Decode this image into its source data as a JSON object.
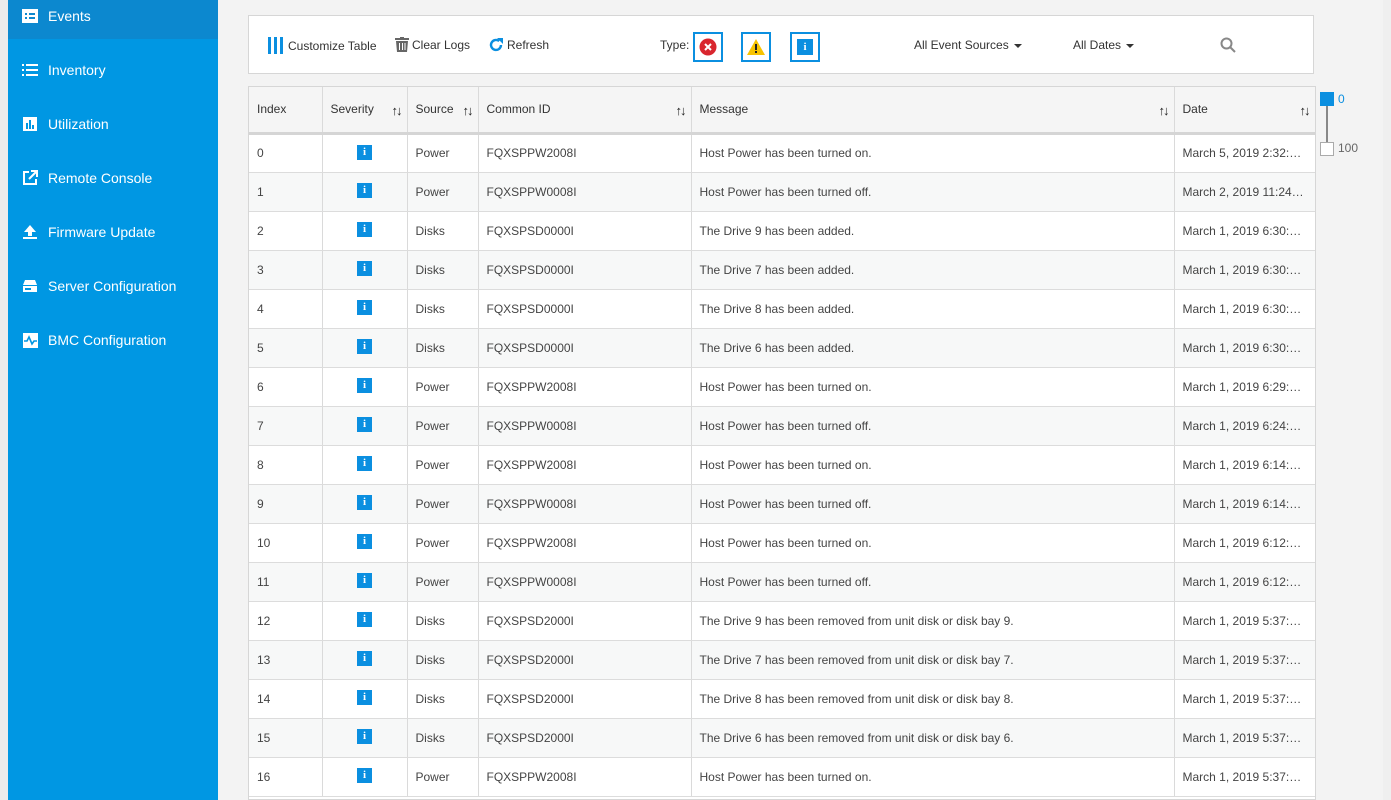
{
  "sidebar": {
    "items": [
      {
        "label": "Events",
        "icon": "events-icon",
        "active": true
      },
      {
        "label": "Inventory",
        "icon": "list-icon",
        "active": false
      },
      {
        "label": "Utilization",
        "icon": "bar-chart-icon",
        "active": false
      },
      {
        "label": "Remote Console",
        "icon": "external-link-icon",
        "active": false
      },
      {
        "label": "Firmware Update",
        "icon": "upload-icon",
        "active": false
      },
      {
        "label": "Server Configuration",
        "icon": "server-icon",
        "active": false
      },
      {
        "label": "BMC Configuration",
        "icon": "pulse-icon",
        "active": false
      }
    ]
  },
  "toolbar": {
    "customize_label": "Customize Table",
    "clear_label": "Clear Logs",
    "refresh_label": "Refresh",
    "type_label": "Type:",
    "sources_label": "All Event Sources",
    "dates_label": "All Dates"
  },
  "colors": {
    "sidebar": "#0097e3",
    "accent": "#0b8fe0",
    "error": "#d9262e",
    "warning": "#f7c300"
  },
  "table": {
    "columns": [
      "Index",
      "Severity",
      "Source",
      "Common ID",
      "Message",
      "Date"
    ],
    "rows": [
      {
        "index": "0",
        "severity": "info",
        "source": "Power",
        "common_id": "FQXSPPW2008I",
        "message": "Host Power has been turned on.",
        "date": "March 5, 2019 2:32:…"
      },
      {
        "index": "1",
        "severity": "info",
        "source": "Power",
        "common_id": "FQXSPPW0008I",
        "message": "Host Power has been turned off.",
        "date": "March 2, 2019 11:24…"
      },
      {
        "index": "2",
        "severity": "info",
        "source": "Disks",
        "common_id": "FQXSPSD0000I",
        "message": "The Drive 9 has been added.",
        "date": "March 1, 2019 6:30:…"
      },
      {
        "index": "3",
        "severity": "info",
        "source": "Disks",
        "common_id": "FQXSPSD0000I",
        "message": "The Drive 7 has been added.",
        "date": "March 1, 2019 6:30:…"
      },
      {
        "index": "4",
        "severity": "info",
        "source": "Disks",
        "common_id": "FQXSPSD0000I",
        "message": "The Drive 8 has been added.",
        "date": "March 1, 2019 6:30:…"
      },
      {
        "index": "5",
        "severity": "info",
        "source": "Disks",
        "common_id": "FQXSPSD0000I",
        "message": "The Drive 6 has been added.",
        "date": "March 1, 2019 6:30:…"
      },
      {
        "index": "6",
        "severity": "info",
        "source": "Power",
        "common_id": "FQXSPPW2008I",
        "message": "Host Power has been turned on.",
        "date": "March 1, 2019 6:29:…"
      },
      {
        "index": "7",
        "severity": "info",
        "source": "Power",
        "common_id": "FQXSPPW0008I",
        "message": "Host Power has been turned off.",
        "date": "March 1, 2019 6:24:…"
      },
      {
        "index": "8",
        "severity": "info",
        "source": "Power",
        "common_id": "FQXSPPW2008I",
        "message": "Host Power has been turned on.",
        "date": "March 1, 2019 6:14:…"
      },
      {
        "index": "9",
        "severity": "info",
        "source": "Power",
        "common_id": "FQXSPPW0008I",
        "message": "Host Power has been turned off.",
        "date": "March 1, 2019 6:14:…"
      },
      {
        "index": "10",
        "severity": "info",
        "source": "Power",
        "common_id": "FQXSPPW2008I",
        "message": "Host Power has been turned on.",
        "date": "March 1, 2019 6:12:…"
      },
      {
        "index": "11",
        "severity": "info",
        "source": "Power",
        "common_id": "FQXSPPW0008I",
        "message": "Host Power has been turned off.",
        "date": "March 1, 2019 6:12:…"
      },
      {
        "index": "12",
        "severity": "info",
        "source": "Disks",
        "common_id": "FQXSPSD2000I",
        "message": "The Drive 9 has been removed from unit disk or disk bay 9.",
        "date": "March 1, 2019 5:37:…"
      },
      {
        "index": "13",
        "severity": "info",
        "source": "Disks",
        "common_id": "FQXSPSD2000I",
        "message": "The Drive 7 has been removed from unit disk or disk bay 7.",
        "date": "March 1, 2019 5:37:…"
      },
      {
        "index": "14",
        "severity": "info",
        "source": "Disks",
        "common_id": "FQXSPSD2000I",
        "message": "The Drive 8 has been removed from unit disk or disk bay 8.",
        "date": "March 1, 2019 5:37:…"
      },
      {
        "index": "15",
        "severity": "info",
        "source": "Disks",
        "common_id": "FQXSPSD2000I",
        "message": "The Drive 6 has been removed from unit disk or disk bay 6.",
        "date": "March 1, 2019 5:37:…"
      },
      {
        "index": "16",
        "severity": "info",
        "source": "Power",
        "common_id": "FQXSPPW2008I",
        "message": "Host Power has been turned on.",
        "date": "March 1, 2019 5:37:…"
      }
    ]
  },
  "range": {
    "top_value": "0",
    "bottom_value": "100"
  }
}
